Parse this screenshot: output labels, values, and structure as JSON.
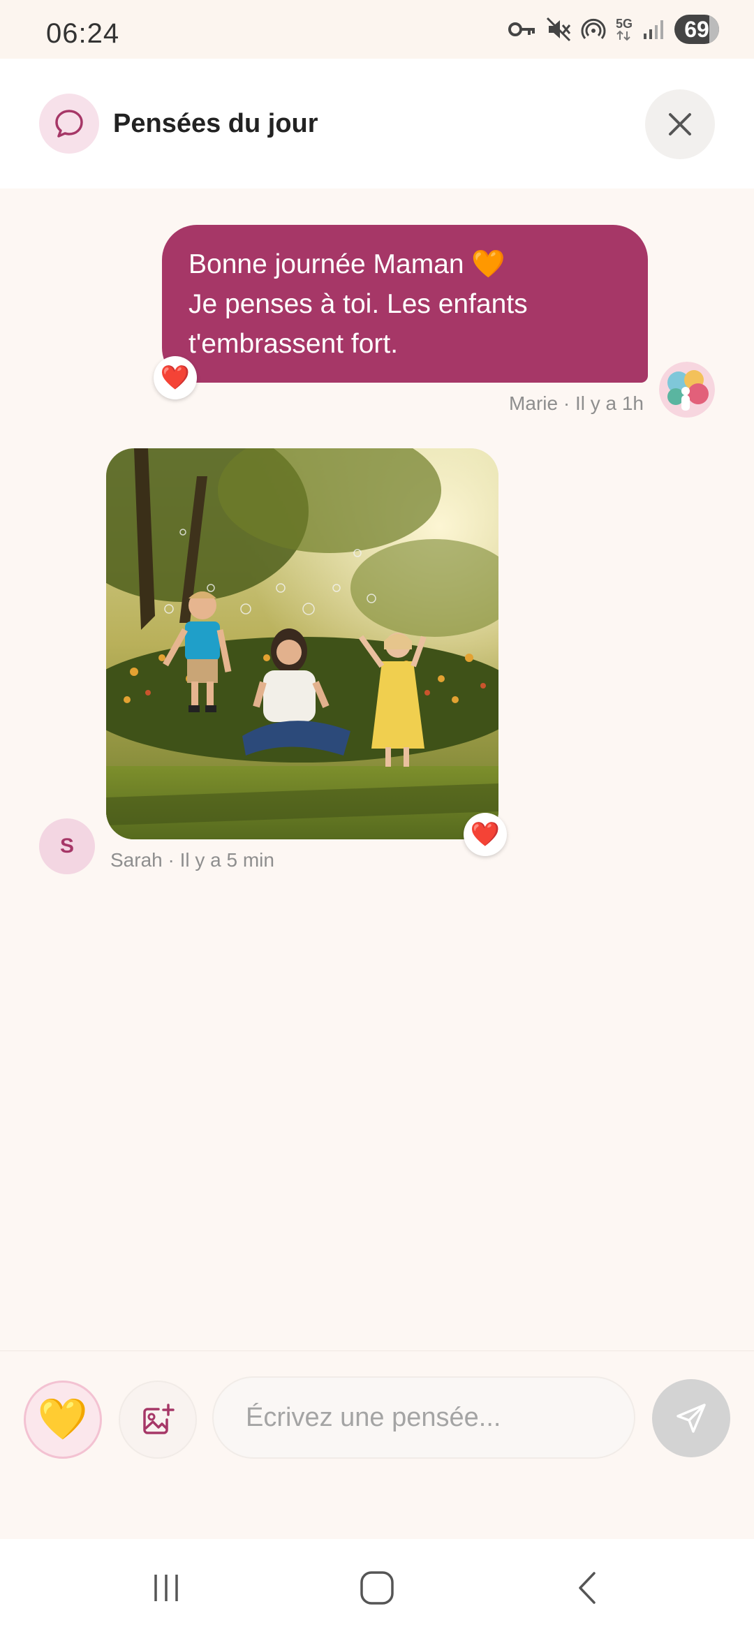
{
  "status_bar": {
    "time": "06:24",
    "battery_level": "69",
    "network": "5G",
    "icons": [
      "vpn-key-icon",
      "mute-icon",
      "hotspot-icon",
      "network-5g-icon",
      "signal-icon",
      "battery-icon"
    ]
  },
  "header": {
    "title": "Pensées du jour",
    "icon": "chat-bubble-icon",
    "close_icon": "close-icon"
  },
  "messages": [
    {
      "type": "text",
      "lines": [
        "Bonne journée Maman 🧡",
        "Je penses à toi.  Les enfants",
        "t'embrassent fort."
      ],
      "meta": "Marie · Il y a 1h",
      "reaction": "❤️",
      "bubble_color": "#a63767"
    },
    {
      "type": "image",
      "image_description": "photo-children-mother-bubbles",
      "meta": "Sarah · Il y a 5 min",
      "avatar_initial": "S",
      "reaction": "❤️"
    }
  ],
  "composer": {
    "heart_emoji": "💛",
    "image_icon": "add-image-icon",
    "placeholder": "Écrivez une pensée...",
    "send_icon": "send-icon"
  },
  "nav": {
    "icons": [
      "recent-apps-icon",
      "home-icon",
      "back-icon"
    ]
  },
  "colors": {
    "accent": "#a63767",
    "background": "#fdf7f3"
  }
}
